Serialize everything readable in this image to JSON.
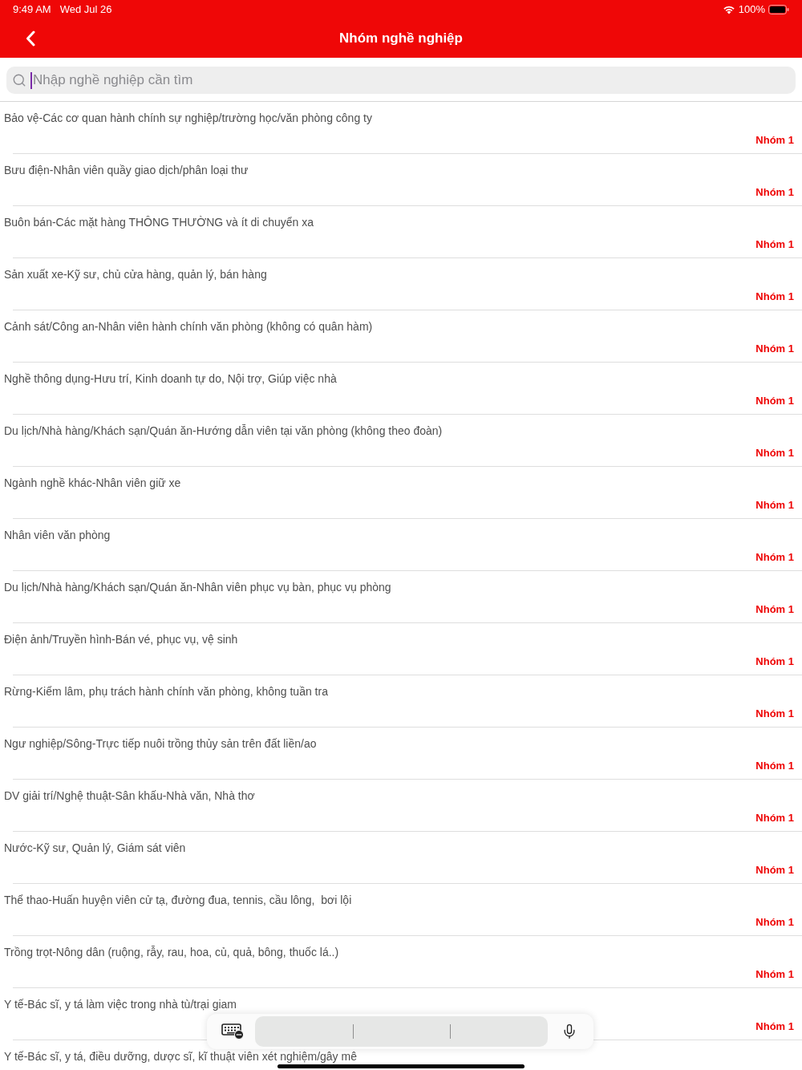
{
  "status_bar": {
    "time": "9:49 AM",
    "date": "Wed Jul 26",
    "battery": "100%"
  },
  "nav_bar": {
    "title": "Nhóm nghề nghiệp"
  },
  "search": {
    "placeholder": "Nhập nghề nghiệp cần tìm",
    "focused": true
  },
  "occupations": [
    {
      "name": "Bảo vệ-Các cơ quan hành chính sự nghiệp/trường học/văn phòng công ty",
      "group": "Nhóm 1"
    },
    {
      "name": "Bưu điện-Nhân viên quầy giao dịch/phân loại thư",
      "group": "Nhóm 1"
    },
    {
      "name": "Buôn bán-Các mặt hàng THÔNG THƯỜNG và ít di chuyển xa",
      "group": "Nhóm 1"
    },
    {
      "name": "Sản xuất xe-Kỹ sư, chủ cửa hàng, quản lý, bán hàng",
      "group": "Nhóm 1"
    },
    {
      "name": "Cảnh sát/Công an-Nhân viên hành chính văn phòng (không có quân hàm)",
      "group": "Nhóm 1"
    },
    {
      "name": "Nghề thông dụng-Hưu trí, Kinh doanh tự do, Nội trợ, Giúp việc nhà",
      "group": "Nhóm 1"
    },
    {
      "name": "Du lịch/Nhà hàng/Khách sạn/Quán ăn-Hướng dẫn viên tại văn phòng (không theo đoàn)",
      "group": "Nhóm 1"
    },
    {
      "name": "Ngành nghề khác-Nhân viên giữ xe",
      "group": "Nhóm 1"
    },
    {
      "name": "Nhân viên văn phòng",
      "group": "Nhóm 1"
    },
    {
      "name": "Du lịch/Nhà hàng/Khách sạn/Quán ăn-Nhân viên phục vụ bàn, phục vụ phòng",
      "group": "Nhóm 1"
    },
    {
      "name": "Điện ảnh/Truyền hình-Bán vé, phục vụ, vệ sinh",
      "group": "Nhóm 1"
    },
    {
      "name": "Rừng-Kiểm lâm, phụ trách hành chính văn phòng, không tuần tra",
      "group": "Nhóm 1"
    },
    {
      "name": "Ngư nghiệp/Sông-Trực tiếp nuôi trồng thủy sản trên đất liền/ao",
      "group": "Nhóm 1"
    },
    {
      "name": "DV giải trí/Nghệ thuật-Sân khấu-Nhà văn, Nhà thơ",
      "group": "Nhóm 1"
    },
    {
      "name": "Nước-Kỹ sư, Quản lý, Giám sát viên",
      "group": "Nhóm 1"
    },
    {
      "name": "Thể thao-Huấn huyện viên cử tạ, đường đua, tennis, cầu lông,  bơi lội",
      "group": "Nhóm 1"
    },
    {
      "name": "Trồng trọt-Nông dân (ruộng, rẫy, rau, hoa, củ, quả, bông, thuốc lá..)",
      "group": "Nhóm 1"
    },
    {
      "name": "Y tế-Bác sĩ, y tá làm việc trong nhà tù/trại giam",
      "group": "Nhóm 1"
    },
    {
      "name": "Y tế-Bác sĩ, y tá, điều dưỡng, dược sĩ, kĩ thuật viên xét nghiệm/gây mê"
    }
  ]
}
